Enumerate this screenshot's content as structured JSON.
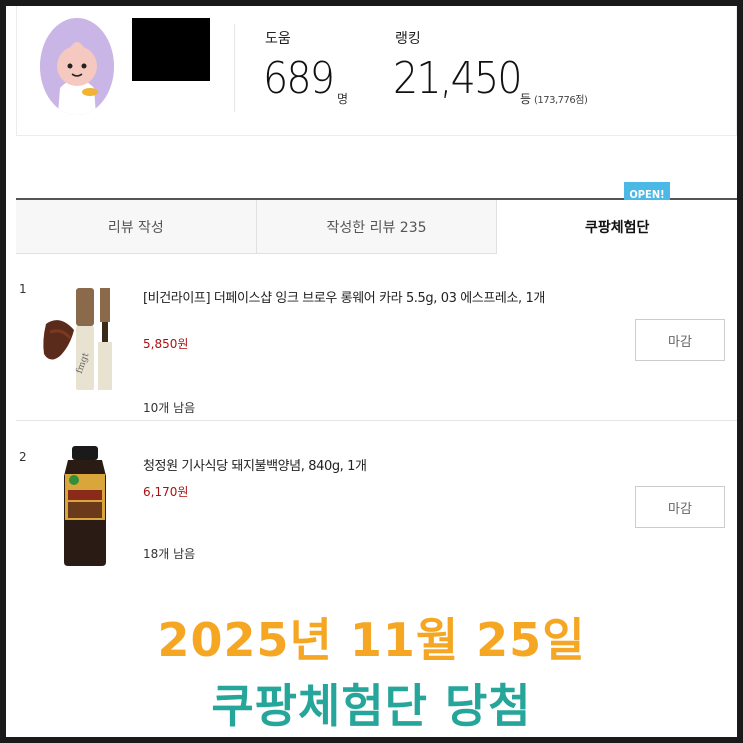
{
  "profile": {
    "help_label": "도움",
    "help_value": "689",
    "help_unit": "명",
    "rank_label": "랭킹",
    "rank_value": "21,450",
    "rank_unit": "등",
    "rank_sub": "(173,776점)"
  },
  "tabs": [
    {
      "label": "리뷰 작성"
    },
    {
      "label": "작성한 리뷰  235"
    },
    {
      "label": "쿠팡체험단"
    }
  ],
  "open_badge": "OPEN!",
  "items": [
    {
      "num": "1",
      "title": "[비건라이프] 더페이스샵 잉크 브로우 롱웨어 카라 5.5g, 03 에스프레소, 1개",
      "price": "5,850원",
      "remaining": "10개 남음",
      "button": "마감"
    },
    {
      "num": "2",
      "title": "청정원 기사식당 돼지불백양념, 840g, 1개",
      "price": "6,170원",
      "remaining": "18개 남음",
      "button": "마감"
    }
  ],
  "banner": {
    "line1": "2025년 11월 25일",
    "line2": "쿠팡체험단 당첨"
  },
  "colors": {
    "banner_orange": "#f5a623",
    "banner_teal": "#26a69a",
    "price_red": "#aa1111",
    "badge_blue": "#4bb8e6"
  }
}
